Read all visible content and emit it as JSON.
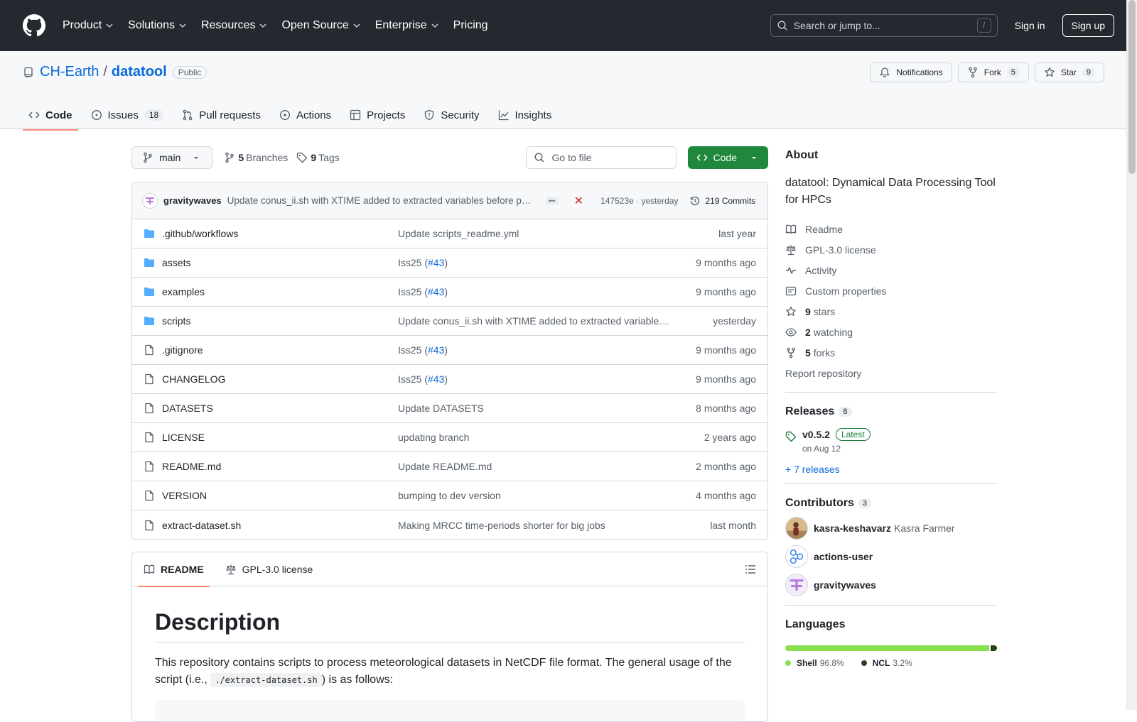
{
  "header": {
    "nav": [
      "Product",
      "Solutions",
      "Resources",
      "Open Source",
      "Enterprise",
      "Pricing"
    ],
    "search_placeholder": "Search or jump to...",
    "search_shortcut": "/",
    "signin": "Sign in",
    "signup": "Sign up"
  },
  "repo": {
    "owner": "CH-Earth",
    "separator": "/",
    "name": "datatool",
    "visibility": "Public",
    "notifications": "Notifications",
    "fork_label": "Fork",
    "fork_count": "5",
    "star_label": "Star",
    "star_count": "9"
  },
  "tabs": [
    {
      "label": "Code",
      "icon": "code-icon",
      "active": true
    },
    {
      "label": "Issues",
      "icon": "issue-icon",
      "count": "18"
    },
    {
      "label": "Pull requests",
      "icon": "pull-request-icon"
    },
    {
      "label": "Actions",
      "icon": "play-icon"
    },
    {
      "label": "Projects",
      "icon": "table-icon"
    },
    {
      "label": "Security",
      "icon": "shield-icon"
    },
    {
      "label": "Insights",
      "icon": "graph-icon"
    }
  ],
  "toolbar": {
    "branch": "main",
    "branches_count": "5",
    "branches_label": "Branches",
    "tags_count": "9",
    "tags_label": "Tags",
    "goto_placeholder": "Go to file",
    "code_button": "Code"
  },
  "commit": {
    "author": "gravitywaves",
    "message": "Update conus_ii.sh with XTIME added to extracted variables before processing",
    "dots": "•••",
    "status": "✕",
    "sha": "147523e",
    "time": "yesterday",
    "sha_time": "147523e · yesterday",
    "count_label": "219 Commits"
  },
  "files": [
    {
      "type": "folder",
      "name": ".github/workflows",
      "message": "Update scripts_readme.yml",
      "ref": "",
      "date": "last year"
    },
    {
      "type": "folder",
      "name": "assets",
      "message": "Iss25 (",
      "ref": "#43",
      "date": "9 months ago"
    },
    {
      "type": "folder",
      "name": "examples",
      "message": "Iss25 (",
      "ref": "#43",
      "date": "9 months ago"
    },
    {
      "type": "folder",
      "name": "scripts",
      "message": "Update conus_ii.sh with XTIME added to extracted variables before processing",
      "ref": "",
      "date": "yesterday"
    },
    {
      "type": "file",
      "name": ".gitignore",
      "message": "Iss25 (",
      "ref": "#43",
      "date": "9 months ago"
    },
    {
      "type": "file",
      "name": "CHANGELOG",
      "message": "Iss25 (",
      "ref": "#43",
      "date": "9 months ago"
    },
    {
      "type": "file",
      "name": "DATASETS",
      "message": "Update DATASETS",
      "ref": "",
      "date": "8 months ago"
    },
    {
      "type": "file",
      "name": "LICENSE",
      "message": "updating branch",
      "ref": "",
      "date": "2 years ago"
    },
    {
      "type": "file",
      "name": "README.md",
      "message": "Update README.md",
      "ref": "",
      "date": "2 months ago"
    },
    {
      "type": "file",
      "name": "VERSION",
      "message": "bumping to dev version",
      "ref": "",
      "date": "4 months ago"
    },
    {
      "type": "file",
      "name": "extract-dataset.sh",
      "message": "Making MRCC time-periods shorter for big jobs",
      "ref": "",
      "date": "last month"
    }
  ],
  "readme": {
    "tab_readme": "README",
    "tab_license": "GPL-3.0 license",
    "heading": "Description",
    "para_before": "This repository contains scripts to process meteorological datasets in NetCDF file format. The general usage of the script (i.e., ",
    "para_code": "./extract-dataset.sh",
    "para_after": ") is as follows:"
  },
  "about": {
    "title": "About",
    "description": "datatool: Dynamical Data Processing Tool for HPCs",
    "items": [
      {
        "icon": "book-icon",
        "bold": "",
        "label": "Readme"
      },
      {
        "icon": "law-icon",
        "bold": "",
        "label": "GPL-3.0 license"
      },
      {
        "icon": "pulse-icon",
        "bold": "",
        "label": "Activity"
      },
      {
        "icon": "note-icon",
        "bold": "",
        "label": "Custom properties"
      },
      {
        "icon": "star-icon",
        "bold": "9",
        "label": "stars"
      },
      {
        "icon": "eye-icon",
        "bold": "2",
        "label": "watching"
      },
      {
        "icon": "fork-icon",
        "bold": "5",
        "label": "forks"
      }
    ],
    "report": "Report repository"
  },
  "releases": {
    "title": "Releases",
    "count": "8",
    "tag": "v0.5.2",
    "latest": "Latest",
    "date": "on Aug 12",
    "more": "+ 7 releases"
  },
  "contributors": {
    "title": "Contributors",
    "count": "3",
    "list": [
      {
        "login": "kasra-keshavarz",
        "name": "Kasra Farmer"
      },
      {
        "login": "actions-user",
        "name": ""
      },
      {
        "login": "gravitywaves",
        "name": ""
      }
    ]
  },
  "languages": {
    "title": "Languages",
    "list": [
      {
        "name": "Shell",
        "percent": "96.8%",
        "value": 96.8,
        "color": "#89e051"
      },
      {
        "name": "NCL",
        "percent": "3.2%",
        "value": 3.2,
        "color": "#28431f"
      }
    ]
  },
  "colors": {
    "header_bg": "#24292f",
    "link": "#0969da",
    "code_button": "#1f883d",
    "active_tab": "#fd8c73",
    "failure": "#cf222e"
  }
}
